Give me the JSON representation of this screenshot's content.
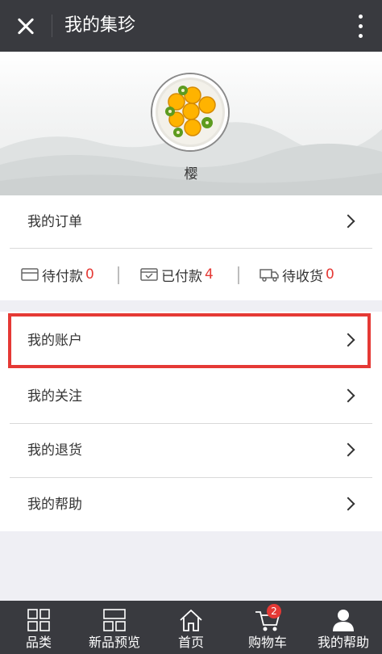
{
  "header": {
    "title": "我的集珍",
    "close_icon": "close-icon",
    "more_icon": "more-vertical-icon"
  },
  "profile": {
    "username": "樱",
    "avatar_icon": "fruit-plate-avatar"
  },
  "orders": {
    "label": "我的订单",
    "statuses": [
      {
        "label": "待付款",
        "count": "0",
        "icon": "card-icon"
      },
      {
        "label": "已付款",
        "count": "4",
        "icon": "paid-box-icon"
      },
      {
        "label": "待收货",
        "count": "0",
        "icon": "truck-icon"
      }
    ]
  },
  "menu": [
    {
      "label": "我的账户"
    },
    {
      "label": "我的关注"
    },
    {
      "label": "我的退货"
    },
    {
      "label": "我的帮助"
    }
  ],
  "bottom_nav": [
    {
      "label": "品类",
      "icon": "grid-icon"
    },
    {
      "label": "新品预览",
      "icon": "layout-icon"
    },
    {
      "label": "首页",
      "icon": "home-icon"
    },
    {
      "label": "购物车",
      "icon": "cart-icon",
      "badge": "2"
    },
    {
      "label": "我的帮助",
      "icon": "user-icon"
    }
  ],
  "colors": {
    "topbar": "#393a3f",
    "accent_red": "#e53935",
    "background": "#efeff4"
  }
}
